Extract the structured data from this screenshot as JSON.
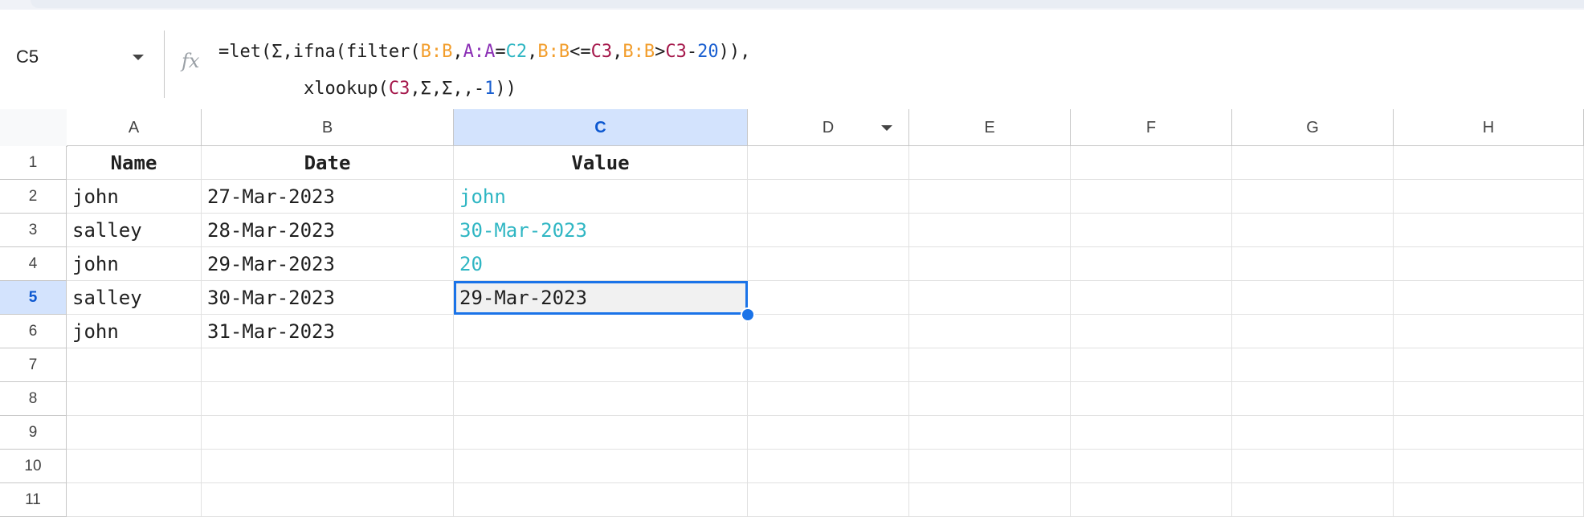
{
  "name_box": {
    "ref": "C5"
  },
  "formula_bar": {
    "fx_label": "fx",
    "line1": [
      {
        "t": "=let(Σ,ifna(filter(",
        "c": ""
      },
      {
        "t": "B:B",
        "c": "orange"
      },
      {
        "t": ",",
        "c": ""
      },
      {
        "t": "A:A",
        "c": "purple"
      },
      {
        "t": "=",
        "c": ""
      },
      {
        "t": "C2",
        "c": "teal"
      },
      {
        "t": ",",
        "c": ""
      },
      {
        "t": "B:B",
        "c": "orange"
      },
      {
        "t": "<=",
        "c": ""
      },
      {
        "t": "C3",
        "c": "maroon"
      },
      {
        "t": ",",
        "c": ""
      },
      {
        "t": "B:B",
        "c": "orange"
      },
      {
        "t": ">",
        "c": ""
      },
      {
        "t": "C3",
        "c": "maroon"
      },
      {
        "t": "-",
        "c": ""
      },
      {
        "t": "20",
        "c": "blue"
      },
      {
        "t": ")),",
        "c": ""
      }
    ],
    "line2": [
      {
        "t": "        xlookup(",
        "c": ""
      },
      {
        "t": "C3",
        "c": "maroon"
      },
      {
        "t": ",Σ,Σ,,-",
        "c": ""
      },
      {
        "t": "1",
        "c": "blue"
      },
      {
        "t": "))",
        "c": ""
      }
    ]
  },
  "columns": [
    "A",
    "B",
    "C",
    "D",
    "E",
    "F",
    "G",
    "H"
  ],
  "rows": [
    "1",
    "2",
    "3",
    "4",
    "5",
    "6",
    "7",
    "8",
    "9",
    "10",
    "11"
  ],
  "selected_cell": {
    "col": "C",
    "row": "5"
  },
  "cells": {
    "header": [
      "Name",
      "Date",
      "Value"
    ],
    "data": [
      [
        "john",
        "27-Mar-2023",
        "john"
      ],
      [
        "salley",
        "28-Mar-2023",
        "30-Mar-2023"
      ],
      [
        "john",
        "29-Mar-2023",
        "20"
      ],
      [
        "salley",
        "30-Mar-2023",
        "29-Mar-2023"
      ],
      [
        "john",
        "31-Mar-2023",
        ""
      ]
    ]
  },
  "colors": {
    "selection": "#1a73e8",
    "header_selected_bg": "#d3e3fd",
    "ref_orange": "#f29d2b",
    "ref_purple": "#8b2fb5",
    "ref_teal": "#2fb6c3",
    "ref_maroon": "#a5184b",
    "number_blue": "#1a5fd0"
  }
}
